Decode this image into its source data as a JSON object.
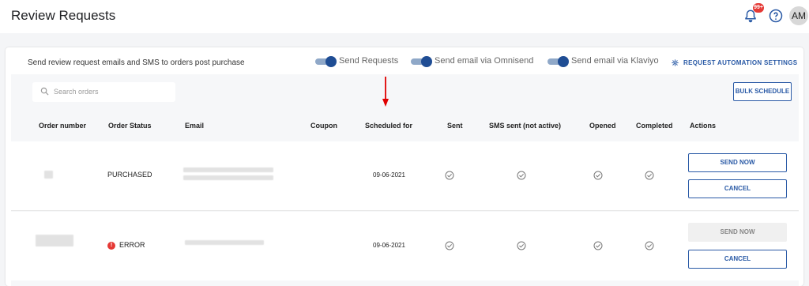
{
  "header": {
    "title": "Review Requests",
    "notification_badge": "99+",
    "avatar_initials": "AM"
  },
  "toolbar": {
    "intro_text": "Send review request emails and SMS to orders post purchase",
    "toggles": [
      {
        "label": "Send Requests",
        "on": true
      },
      {
        "label": "Send email via Omnisend",
        "on": true
      },
      {
        "label": "Send email via Klaviyo",
        "on": true
      }
    ],
    "settings_link": "REQUEST AUTOMATION SETTINGS"
  },
  "search": {
    "placeholder": "Search orders",
    "value": ""
  },
  "bulk_schedule_label": "BULK SCHEDULE",
  "table": {
    "columns": [
      "Order number",
      "Order Status",
      "Email",
      "Coupon",
      "Scheduled for",
      "Sent",
      "SMS sent (not active)",
      "Opened",
      "Completed",
      "Actions"
    ],
    "rows": [
      {
        "status": "PURCHASED",
        "status_error": false,
        "scheduled_for": "09-06-2021",
        "send_now_label": "SEND NOW",
        "send_now_enabled": true,
        "cancel_label": "CANCEL"
      },
      {
        "status": "ERROR",
        "status_error": true,
        "scheduled_for": "09-06-2021",
        "send_now_label": "SEND NOW",
        "send_now_enabled": false,
        "cancel_label": "CANCEL"
      }
    ]
  },
  "colors": {
    "accent": "#2a5aa6",
    "toggle_knob": "#1f4d94",
    "error": "#e53935",
    "annotation_arrow": "#e00000"
  }
}
